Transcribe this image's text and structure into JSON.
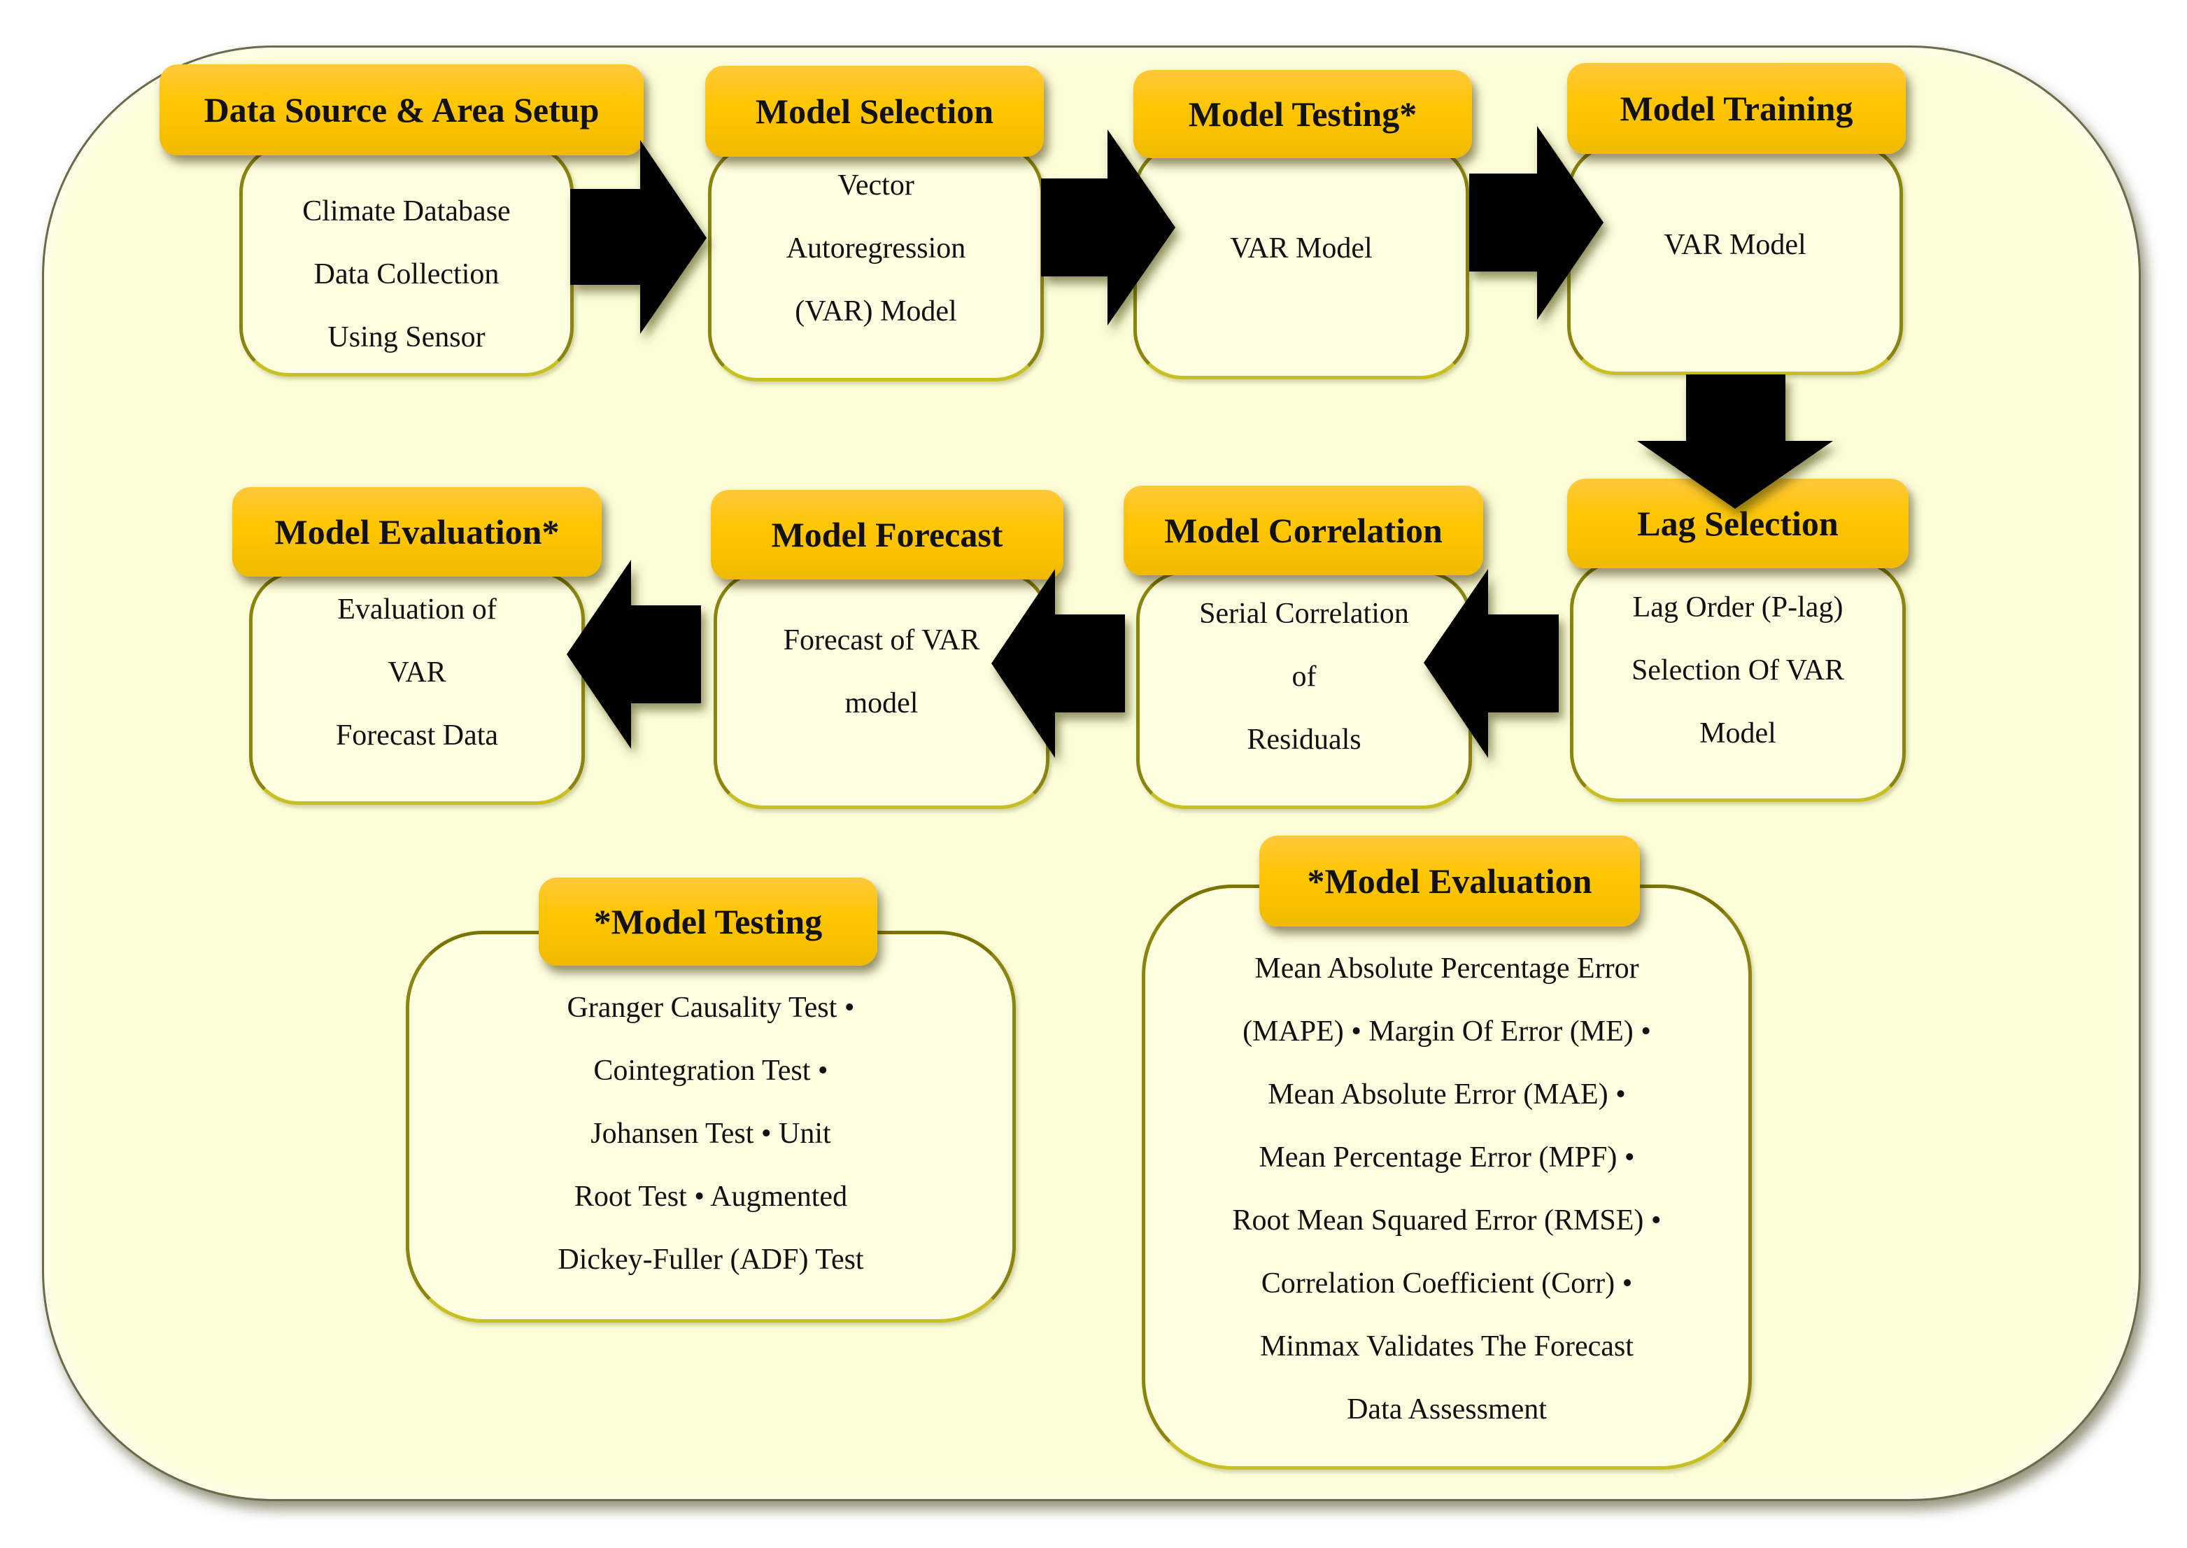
{
  "diagram": {
    "steps": [
      {
        "id": "data-source",
        "title": "Data Source & Area Setup",
        "lines": [
          "Climate Database",
          "Data Collection",
          "Using Sensor"
        ]
      },
      {
        "id": "model-selection",
        "title": "Model Selection",
        "lines": [
          "Vector",
          "Autoregression",
          "(VAR) Model"
        ]
      },
      {
        "id": "model-testing",
        "title": "Model Testing*",
        "lines": [
          "VAR Model"
        ]
      },
      {
        "id": "model-training",
        "title": "Model Training",
        "lines": [
          "VAR Model"
        ]
      },
      {
        "id": "lag-selection",
        "title": "Lag Selection",
        "lines": [
          "Lag Order (P-lag)",
          "Selection Of VAR",
          "Model"
        ]
      },
      {
        "id": "model-correlation",
        "title": "Model Correlation",
        "lines": [
          "Serial Correlation",
          "of",
          "Residuals"
        ]
      },
      {
        "id": "model-forecast",
        "title": "Model Forecast",
        "lines": [
          "Forecast of VAR",
          "model"
        ]
      },
      {
        "id": "model-evaluation",
        "title": "Model Evaluation*",
        "lines": [
          "Evaluation of",
          "VAR",
          "Forecast Data"
        ]
      }
    ],
    "flow": [
      "data-source",
      "model-selection",
      "model-testing",
      "model-training",
      "lag-selection",
      "model-correlation",
      "model-forecast",
      "model-evaluation"
    ],
    "notes": [
      {
        "id": "testing-note",
        "title": "*Model Testing",
        "lines": [
          "Granger Causality Test •",
          "Cointegration  Test •",
          "Johansen Test • Unit",
          "Root Test • Augmented",
          "Dickey-Fuller  (ADF) Test"
        ]
      },
      {
        "id": "evaluation-note",
        "title": "*Model Evaluation",
        "lines": [
          "Mean Absolute Percentage Error",
          "(MAPE) • Margin Of Error (ME) •",
          "Mean Absolute Error (MAE) •",
          "Mean Percentage Error (MPF) •",
          "Root Mean Squared Error (RMSE) •",
          "Correlation Coefficient (Corr) •",
          "Minmax Validates The Forecast",
          "Data Assessment"
        ]
      }
    ],
    "colors": {
      "header": "#ffc600",
      "panel": "#fdfdd8",
      "box_border": "#8a8410",
      "arrow": "#000000"
    }
  }
}
